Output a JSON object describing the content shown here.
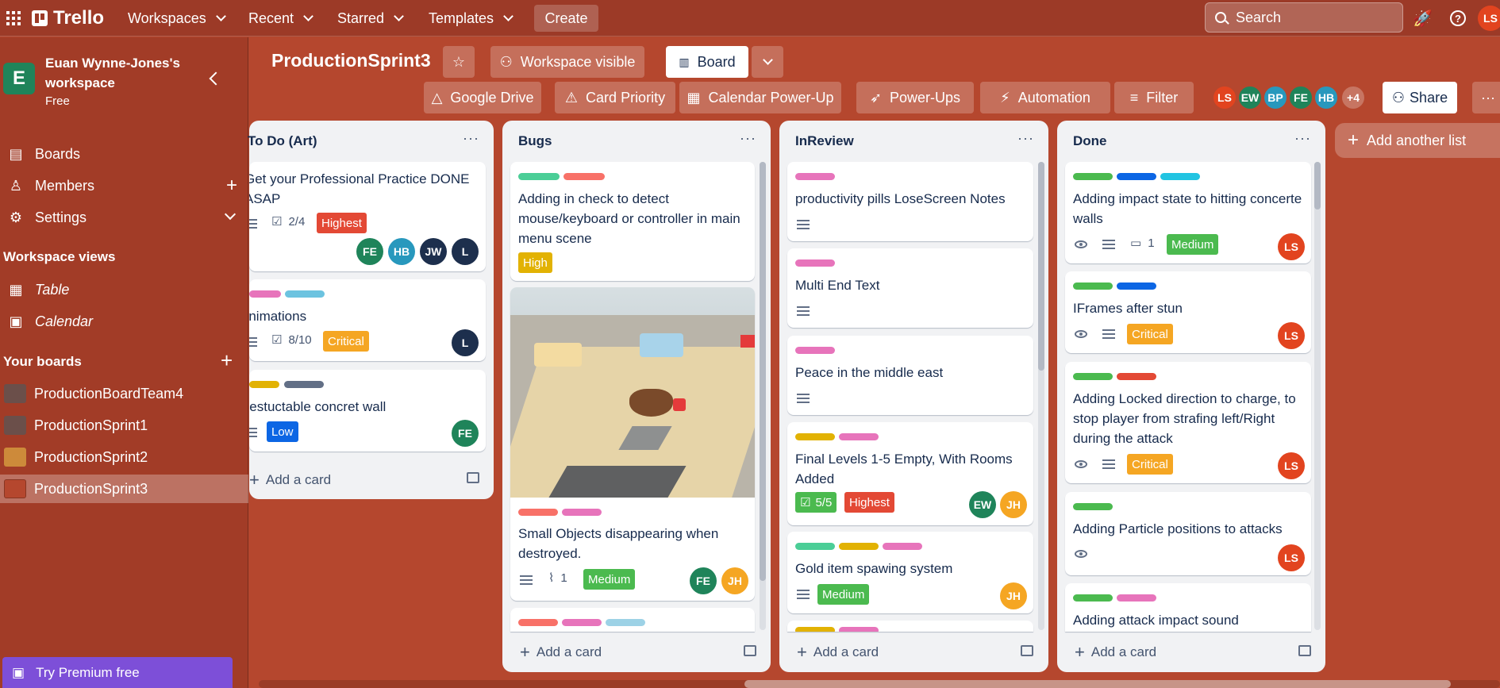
{
  "topbar": {
    "logo": "Trello",
    "workspaces": "Workspaces",
    "recent": "Recent",
    "starred": "Starred",
    "templates": "Templates",
    "create": "Create",
    "search_placeholder": "Search",
    "user_initials": "LS"
  },
  "sidebar": {
    "workspace_initial": "E",
    "workspace_name": "Euan Wynne-Jones's workspace",
    "plan": "Free",
    "nav": [
      {
        "label": "Boards"
      },
      {
        "label": "Members"
      },
      {
        "label": "Settings"
      }
    ],
    "views_heading": "Workspace views",
    "views": [
      {
        "label": "Table"
      },
      {
        "label": "Calendar"
      }
    ],
    "boards_heading": "Your boards",
    "boards": [
      {
        "label": "ProductionBoardTeam4",
        "color": "#6b4f4a"
      },
      {
        "label": "ProductionSprint1",
        "color": "#6b4f4a"
      },
      {
        "label": "ProductionSprint2",
        "color": "#cd8a3a"
      },
      {
        "label": "ProductionSprint3",
        "color": "#b5472e"
      }
    ],
    "premium": "Try Premium free"
  },
  "board": {
    "title": "ProductionSprint3",
    "visibility": "Workspace visible",
    "view": "Board",
    "powerups": [
      "Google Drive",
      "Card Priority",
      "Calendar Power-Up",
      "Power-Ups",
      "Automation"
    ],
    "filter": "Filter",
    "members": [
      {
        "initials": "LS",
        "color": "#e2441f"
      },
      {
        "initials": "EW",
        "color": "#1f845a"
      },
      {
        "initials": "BP",
        "color": "#2898bd"
      },
      {
        "initials": "FE",
        "color": "#1f845a"
      },
      {
        "initials": "HB",
        "color": "#2898bd"
      }
    ],
    "more_members": "+4",
    "share": "Share"
  },
  "lists": [
    {
      "title": "To Do (Art)",
      "cards": [
        {
          "title": "Get your Professional Practice DONE ASAP",
          "checklist": "2/4",
          "priority": "Highest",
          "members": [
            "FE",
            "HB",
            "JW",
            "L"
          ]
        },
        {
          "title": "Animations",
          "checklist": "8/10",
          "priority": "Critical",
          "members": [
            "L"
          ]
        },
        {
          "title": "Destuctable concret wall",
          "priority": "Low",
          "members": [
            "FE"
          ]
        }
      ],
      "add": "Add a card"
    },
    {
      "title": "Bugs",
      "cards": [
        {
          "title": "Adding in check to detect mouse/keyboard or controller in main menu scene",
          "priority": "High"
        },
        {
          "title": "Small Objects disappearing when destroyed.",
          "attachments": "1",
          "priority": "Medium",
          "members": [
            "FE",
            "JH"
          ]
        }
      ],
      "add": "Add a card"
    },
    {
      "title": "InReview",
      "cards": [
        {
          "title": "productivity pills LoseScreen Notes"
        },
        {
          "title": "Multi End Text"
        },
        {
          "title": "Peace in the middle east"
        },
        {
          "title": "Final Levels 1-5 Empty, With Rooms Added",
          "checklist": "5/5",
          "priority": "Highest",
          "members": [
            "EW",
            "JH"
          ]
        },
        {
          "title": "Gold item spawing system",
          "priority": "Medium",
          "members": [
            "JH"
          ]
        }
      ],
      "add": "Add a card"
    },
    {
      "title": "Done",
      "cards": [
        {
          "title": "Adding impact state to hitting concerte walls",
          "comments": "1",
          "priority": "Medium",
          "members": [
            "LS"
          ]
        },
        {
          "title": "IFrames after stun",
          "priority": "Critical",
          "members": [
            "LS"
          ]
        },
        {
          "title": "Adding Locked direction to charge, to stop player from strafing left/Right during the attack",
          "priority": "Critical",
          "members": [
            "LS"
          ]
        },
        {
          "title": "Adding Particle positions to attacks",
          "members": [
            "LS"
          ]
        },
        {
          "title": "Adding attack impact sound"
        }
      ],
      "add": "Add a card"
    }
  ],
  "add_list": "Add another list",
  "colors": {
    "green": "#4bce97",
    "red": "#f87168",
    "purple": "#e774bb",
    "cyan": "#6cc3e0",
    "yellow": "#e2b203",
    "blue": "#0c66e4",
    "slate": "#626f86"
  }
}
